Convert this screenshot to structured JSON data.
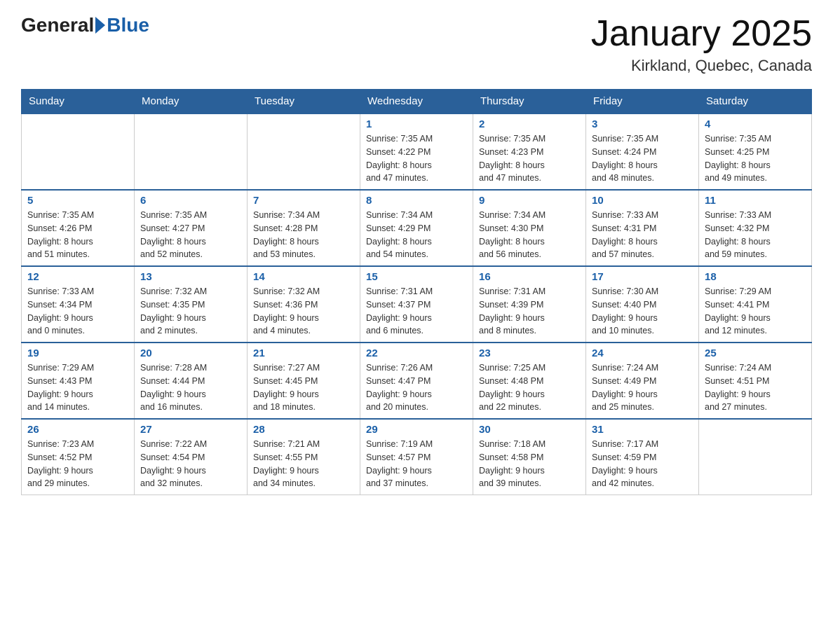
{
  "header": {
    "logo_general": "General",
    "logo_blue": "Blue",
    "month_title": "January 2025",
    "location": "Kirkland, Quebec, Canada"
  },
  "days_of_week": [
    "Sunday",
    "Monday",
    "Tuesday",
    "Wednesday",
    "Thursday",
    "Friday",
    "Saturday"
  ],
  "weeks": [
    [
      {
        "day": "",
        "info": ""
      },
      {
        "day": "",
        "info": ""
      },
      {
        "day": "",
        "info": ""
      },
      {
        "day": "1",
        "info": "Sunrise: 7:35 AM\nSunset: 4:22 PM\nDaylight: 8 hours\nand 47 minutes."
      },
      {
        "day": "2",
        "info": "Sunrise: 7:35 AM\nSunset: 4:23 PM\nDaylight: 8 hours\nand 47 minutes."
      },
      {
        "day": "3",
        "info": "Sunrise: 7:35 AM\nSunset: 4:24 PM\nDaylight: 8 hours\nand 48 minutes."
      },
      {
        "day": "4",
        "info": "Sunrise: 7:35 AM\nSunset: 4:25 PM\nDaylight: 8 hours\nand 49 minutes."
      }
    ],
    [
      {
        "day": "5",
        "info": "Sunrise: 7:35 AM\nSunset: 4:26 PM\nDaylight: 8 hours\nand 51 minutes."
      },
      {
        "day": "6",
        "info": "Sunrise: 7:35 AM\nSunset: 4:27 PM\nDaylight: 8 hours\nand 52 minutes."
      },
      {
        "day": "7",
        "info": "Sunrise: 7:34 AM\nSunset: 4:28 PM\nDaylight: 8 hours\nand 53 minutes."
      },
      {
        "day": "8",
        "info": "Sunrise: 7:34 AM\nSunset: 4:29 PM\nDaylight: 8 hours\nand 54 minutes."
      },
      {
        "day": "9",
        "info": "Sunrise: 7:34 AM\nSunset: 4:30 PM\nDaylight: 8 hours\nand 56 minutes."
      },
      {
        "day": "10",
        "info": "Sunrise: 7:33 AM\nSunset: 4:31 PM\nDaylight: 8 hours\nand 57 minutes."
      },
      {
        "day": "11",
        "info": "Sunrise: 7:33 AM\nSunset: 4:32 PM\nDaylight: 8 hours\nand 59 minutes."
      }
    ],
    [
      {
        "day": "12",
        "info": "Sunrise: 7:33 AM\nSunset: 4:34 PM\nDaylight: 9 hours\nand 0 minutes."
      },
      {
        "day": "13",
        "info": "Sunrise: 7:32 AM\nSunset: 4:35 PM\nDaylight: 9 hours\nand 2 minutes."
      },
      {
        "day": "14",
        "info": "Sunrise: 7:32 AM\nSunset: 4:36 PM\nDaylight: 9 hours\nand 4 minutes."
      },
      {
        "day": "15",
        "info": "Sunrise: 7:31 AM\nSunset: 4:37 PM\nDaylight: 9 hours\nand 6 minutes."
      },
      {
        "day": "16",
        "info": "Sunrise: 7:31 AM\nSunset: 4:39 PM\nDaylight: 9 hours\nand 8 minutes."
      },
      {
        "day": "17",
        "info": "Sunrise: 7:30 AM\nSunset: 4:40 PM\nDaylight: 9 hours\nand 10 minutes."
      },
      {
        "day": "18",
        "info": "Sunrise: 7:29 AM\nSunset: 4:41 PM\nDaylight: 9 hours\nand 12 minutes."
      }
    ],
    [
      {
        "day": "19",
        "info": "Sunrise: 7:29 AM\nSunset: 4:43 PM\nDaylight: 9 hours\nand 14 minutes."
      },
      {
        "day": "20",
        "info": "Sunrise: 7:28 AM\nSunset: 4:44 PM\nDaylight: 9 hours\nand 16 minutes."
      },
      {
        "day": "21",
        "info": "Sunrise: 7:27 AM\nSunset: 4:45 PM\nDaylight: 9 hours\nand 18 minutes."
      },
      {
        "day": "22",
        "info": "Sunrise: 7:26 AM\nSunset: 4:47 PM\nDaylight: 9 hours\nand 20 minutes."
      },
      {
        "day": "23",
        "info": "Sunrise: 7:25 AM\nSunset: 4:48 PM\nDaylight: 9 hours\nand 22 minutes."
      },
      {
        "day": "24",
        "info": "Sunrise: 7:24 AM\nSunset: 4:49 PM\nDaylight: 9 hours\nand 25 minutes."
      },
      {
        "day": "25",
        "info": "Sunrise: 7:24 AM\nSunset: 4:51 PM\nDaylight: 9 hours\nand 27 minutes."
      }
    ],
    [
      {
        "day": "26",
        "info": "Sunrise: 7:23 AM\nSunset: 4:52 PM\nDaylight: 9 hours\nand 29 minutes."
      },
      {
        "day": "27",
        "info": "Sunrise: 7:22 AM\nSunset: 4:54 PM\nDaylight: 9 hours\nand 32 minutes."
      },
      {
        "day": "28",
        "info": "Sunrise: 7:21 AM\nSunset: 4:55 PM\nDaylight: 9 hours\nand 34 minutes."
      },
      {
        "day": "29",
        "info": "Sunrise: 7:19 AM\nSunset: 4:57 PM\nDaylight: 9 hours\nand 37 minutes."
      },
      {
        "day": "30",
        "info": "Sunrise: 7:18 AM\nSunset: 4:58 PM\nDaylight: 9 hours\nand 39 minutes."
      },
      {
        "day": "31",
        "info": "Sunrise: 7:17 AM\nSunset: 4:59 PM\nDaylight: 9 hours\nand 42 minutes."
      },
      {
        "day": "",
        "info": ""
      }
    ]
  ]
}
